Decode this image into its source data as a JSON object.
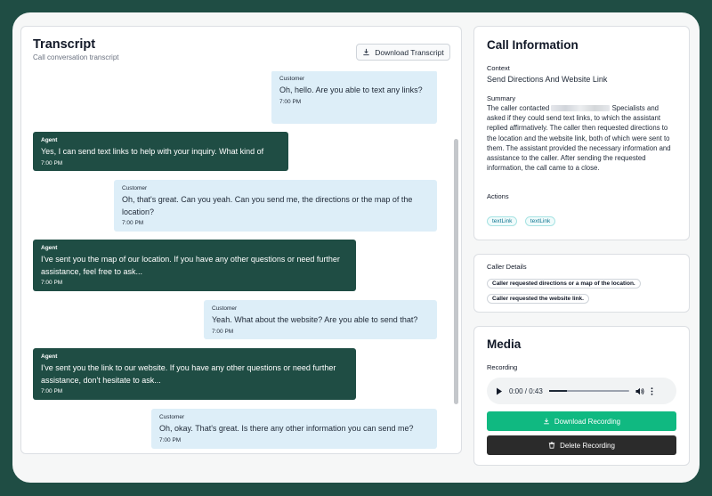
{
  "transcript": {
    "title": "Transcript",
    "subtitle": "Call conversation transcript",
    "download_label": "Download Transcript",
    "messages": [
      {
        "role": "customer",
        "speaker": "Customer",
        "text": "Oh, hello. Are you able to text any links?",
        "time": "7:00 PM"
      },
      {
        "role": "agent",
        "speaker": "Agent",
        "text": "Yes, I can send text links to help with your inquiry. What kind of",
        "time": "7:00 PM"
      },
      {
        "role": "customer",
        "speaker": "Customer",
        "text": "Oh, that's great. Can you yeah. Can you send me, the directions or the map of the location?",
        "time": "7:00 PM"
      },
      {
        "role": "agent",
        "speaker": "Agent",
        "text": "I've sent you the map of our location. If you have any other questions or need further assistance, feel free to ask...",
        "time": "7:00 PM"
      },
      {
        "role": "customer",
        "speaker": "Customer",
        "text": "Yeah. What about the website? Are you able to send that?",
        "time": "7:00 PM"
      },
      {
        "role": "agent",
        "speaker": "Agent",
        "text": "I've sent you the link to our website. If you have any other questions or need further assistance, don't hesitate to ask...",
        "time": "7:00 PM"
      },
      {
        "role": "customer",
        "speaker": "Customer",
        "text": "Oh, okay. That's great. Is there any other information you can send me?",
        "time": "7:00 PM"
      }
    ]
  },
  "call_info": {
    "title": "Call Information",
    "context_label": "Context",
    "context_value": "Send Directions And Website Link",
    "summary_label": "Summary",
    "summary_prefix": "The caller contacted",
    "summary_suffix": "Specialists and asked if they could send text links, to which the assistant replied affirmatively. The caller then requested directions to the location and the website link, both of which were sent to them. The assistant provided the necessary information and assistance to the caller. After sending the requested information, the call came to a close.",
    "actions_label": "Actions",
    "actions": [
      "textLink",
      "textLink"
    ]
  },
  "caller_details": {
    "label": "Caller Details",
    "items": [
      "Caller requested directions or a map of the location.",
      "Caller requested the website link."
    ]
  },
  "media": {
    "title": "Media",
    "recording_label": "Recording",
    "time_display": "0:00 / 0:43",
    "progress": 0.22,
    "download_label": "Download Recording",
    "delete_label": "Delete Recording"
  },
  "colors": {
    "agent_bubble": "#1f4d44",
    "customer_bubble": "#ddeef8",
    "download_button": "#10b981",
    "delete_button": "#2b2b2b"
  }
}
